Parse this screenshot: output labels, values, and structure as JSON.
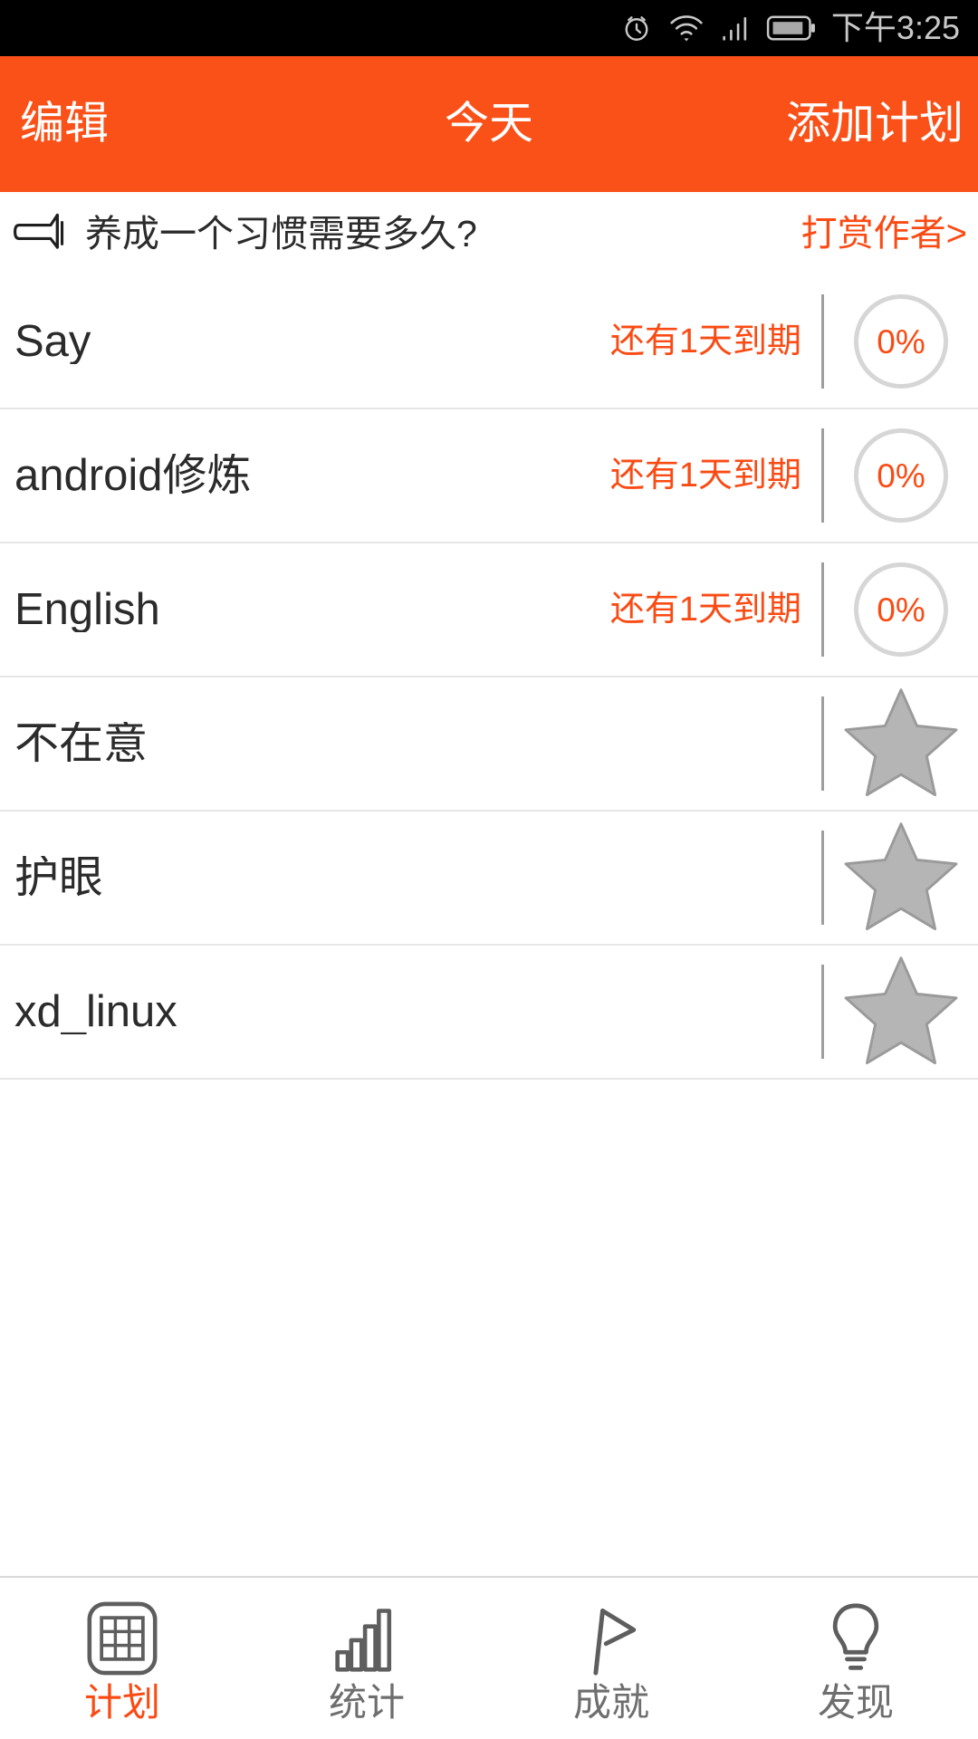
{
  "status_bar": {
    "time": "下午3:25",
    "icons": [
      "alarm-icon",
      "wifi-icon",
      "signal-icon",
      "battery-icon"
    ],
    "background": "#000000",
    "foreground": "#c8c8c8"
  },
  "app_bar": {
    "left_button": "编辑",
    "title": "今天",
    "right_button": "添加计划",
    "background": "#fa5119",
    "text_color": "#ffffff"
  },
  "banner": {
    "icon": "megaphone-icon",
    "text": "养成一个习惯需要多久?",
    "action_label": "打赏作者>",
    "action_color": "#fa4b14"
  },
  "plans": [
    {
      "name": "Say",
      "due": "还有1天到期",
      "indicator": "progress",
      "progress": "0%",
      "progress_value": 0,
      "star": false
    },
    {
      "name": "android修炼",
      "due": "还有1天到期",
      "indicator": "progress",
      "progress": "0%",
      "progress_value": 0,
      "star": false
    },
    {
      "name": "English",
      "due": "还有1天到期",
      "indicator": "progress",
      "progress": "0%",
      "progress_value": 0,
      "star": false
    },
    {
      "name": "不在意",
      "due": "",
      "indicator": "star",
      "progress": "",
      "progress_value": null,
      "star": true
    },
    {
      "name": "护眼",
      "due": "",
      "indicator": "star",
      "progress": "",
      "progress_value": null,
      "star": true
    },
    {
      "name": "xd_linux",
      "due": "",
      "indicator": "star",
      "progress": "",
      "progress_value": null,
      "star": true
    }
  ],
  "tab_bar": {
    "active_index": 0,
    "active_color": "#fa4b14",
    "inactive_color": "#6e6e6e",
    "items": [
      {
        "label": "计划",
        "icon": "calendar-grid-icon"
      },
      {
        "label": "统计",
        "icon": "bar-chart-icon"
      },
      {
        "label": "成就",
        "icon": "flag-icon"
      },
      {
        "label": "发现",
        "icon": "lightbulb-icon"
      }
    ]
  }
}
